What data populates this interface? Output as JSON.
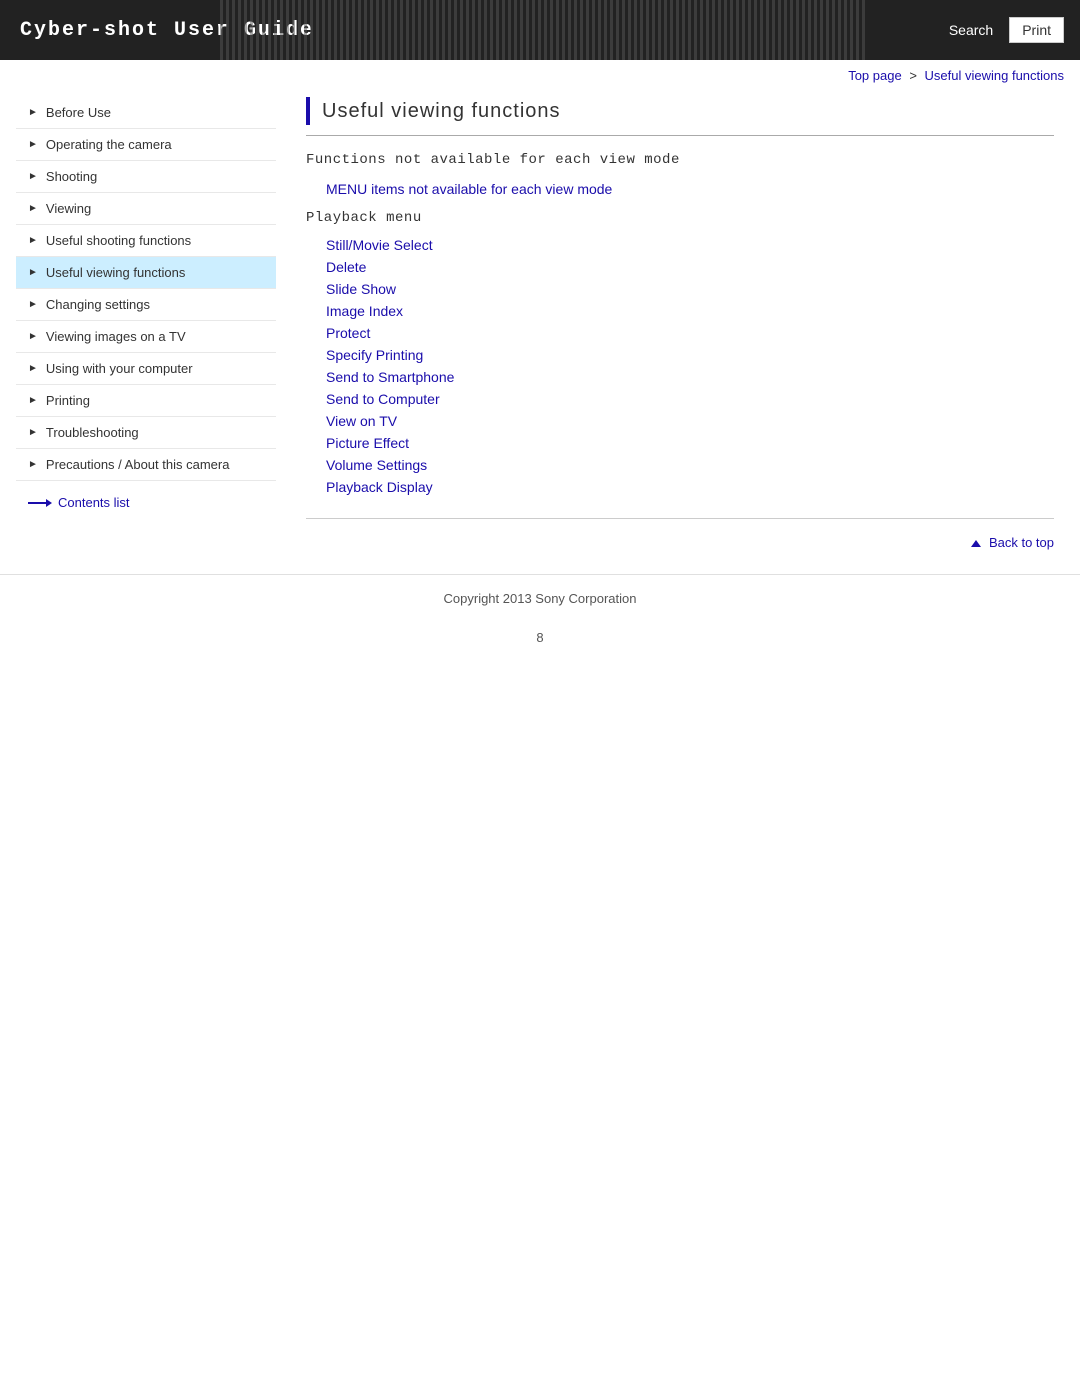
{
  "header": {
    "title": "Cyber-shot User Guide",
    "search_label": "Search",
    "print_label": "Print"
  },
  "breadcrumb": {
    "top_page": "Top page",
    "separator": ">",
    "current": "Useful viewing functions"
  },
  "sidebar": {
    "items": [
      {
        "label": "Before Use",
        "active": false
      },
      {
        "label": "Operating the camera",
        "active": false
      },
      {
        "label": "Shooting",
        "active": false
      },
      {
        "label": "Viewing",
        "active": false
      },
      {
        "label": "Useful shooting functions",
        "active": false
      },
      {
        "label": "Useful viewing functions",
        "active": true
      },
      {
        "label": "Changing settings",
        "active": false
      },
      {
        "label": "Viewing images on a TV",
        "active": false
      },
      {
        "label": "Using with your computer",
        "active": false
      },
      {
        "label": "Printing",
        "active": false
      },
      {
        "label": "Troubleshooting",
        "active": false
      },
      {
        "label": "Precautions / About this camera",
        "active": false
      }
    ],
    "contents_list": "Contents list"
  },
  "content": {
    "page_title": "Useful viewing functions",
    "section1_title": "Functions not available for each view mode",
    "section1_link": "MENU items not available for each view mode",
    "section2_title": "Playback menu",
    "playback_links": [
      "Still/Movie Select",
      "Delete",
      "Slide Show",
      "Image Index",
      "Protect",
      "Specify Printing",
      "Send to Smartphone",
      "Send to Computer",
      "View on TV",
      "Picture Effect",
      "Volume Settings",
      "Playback Display"
    ]
  },
  "back_to_top": "Back to top",
  "footer": {
    "copyright": "Copyright 2013 Sony Corporation"
  },
  "page_number": "8"
}
